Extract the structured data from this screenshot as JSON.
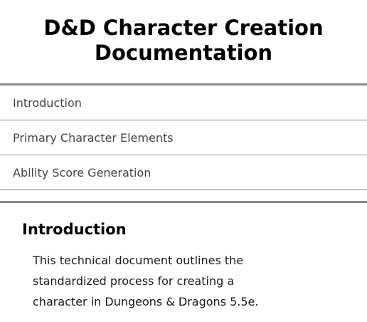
{
  "page": {
    "title": "D&D Character Creation Documentation"
  },
  "toc": {
    "items": [
      {
        "label": "Introduction"
      },
      {
        "label": "Primary Character Elements"
      },
      {
        "label": "Ability Score Generation"
      }
    ]
  },
  "main": {
    "section_title": "Introduction",
    "section_text": "This technical document outlines the standardized process for creating a character in Dungeons & Dragons 5.5e."
  },
  "colors": {
    "rule": "#8a8a8a",
    "toc_text": "#444444",
    "heading": "#000000"
  }
}
